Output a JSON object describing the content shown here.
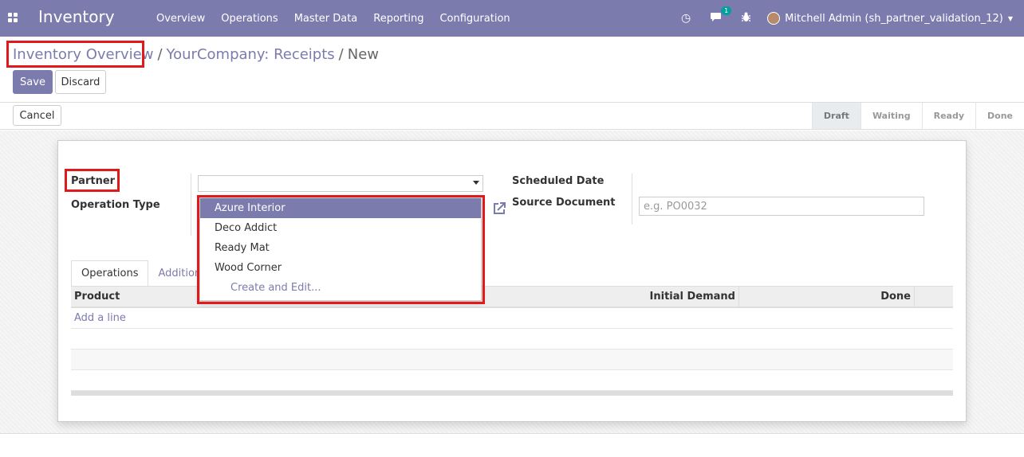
{
  "topbar": {
    "app_title": "Inventory",
    "menu": [
      "Overview",
      "Operations",
      "Master Data",
      "Reporting",
      "Configuration"
    ],
    "chat_badge": "1",
    "user_name": "Mitchell Admin (sh_partner_validation_12)"
  },
  "breadcrumb": {
    "items": [
      "Inventory Overview",
      "YourCompany: Receipts"
    ],
    "current": "New",
    "separator": "/"
  },
  "buttons": {
    "save": "Save",
    "discard": "Discard",
    "cancel": "Cancel"
  },
  "stages": [
    "Draft",
    "Waiting",
    "Ready",
    "Done"
  ],
  "active_stage": "Draft",
  "form": {
    "partner_label": "Partner",
    "operation_type_label": "Operation Type",
    "scheduled_date_label": "Scheduled Date",
    "source_document_label": "Source Document",
    "source_document_placeholder": "e.g. PO0032"
  },
  "dropdown": {
    "options": [
      "Azure Interior",
      "Deco Addict",
      "Ready Mat",
      "Wood Corner"
    ],
    "selected": "Azure Interior",
    "create_edit": "Create and Edit..."
  },
  "tabs": [
    "Operations",
    "Additiona"
  ],
  "table": {
    "columns": [
      "Product",
      "Initial Demand",
      "Done"
    ],
    "add_line": "Add a line"
  },
  "colors": {
    "brand": "#7c7bad",
    "highlight": "#e0191a"
  }
}
